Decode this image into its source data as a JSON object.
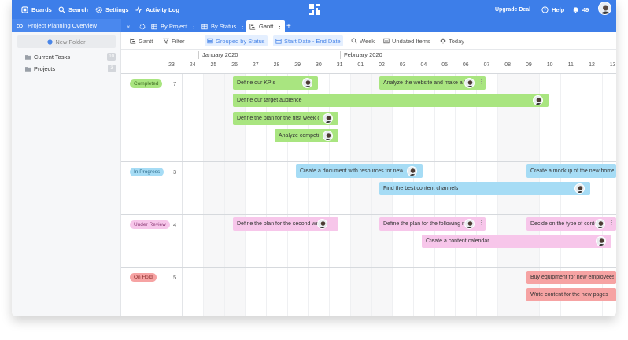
{
  "colors": {
    "accent": "#3d7ee9",
    "completed": "#a9e580",
    "in_progress": "#a6dcf5",
    "under_review": "#f7c6ea",
    "on_hold": "#f6a3a3"
  },
  "topbar": {
    "boards": "Boards",
    "search": "Search",
    "settings": "Settings",
    "activity": "Activity Log",
    "upgrade": "Upgrade Deal",
    "help": "Help",
    "notifications": "49"
  },
  "subbar": {
    "project": "Project Planning Overview",
    "tabs": [
      "By Project",
      "By Status",
      "Gantt"
    ]
  },
  "sidebar": {
    "new_folder": "New Folder",
    "folders": [
      {
        "label": "Current Tasks",
        "count": "10"
      },
      {
        "label": "Projects",
        "count": "3"
      }
    ]
  },
  "toolbar": {
    "gantt": "Gantt",
    "filter": "Filter",
    "grouped": "Grouped by Status",
    "dates": "Start Date - End Date",
    "week": "Week",
    "undated": "Undated Items",
    "today": "Today"
  },
  "timeline": {
    "months": [
      "January 2020",
      "February 2020"
    ],
    "days": [
      "23",
      "24",
      "25",
      "26",
      "27",
      "28",
      "29",
      "30",
      "31",
      "01",
      "02",
      "03",
      "04",
      "05",
      "06",
      "07",
      "08",
      "09",
      "10",
      "11",
      "12",
      "13"
    ]
  },
  "groups": [
    {
      "status": "Completed",
      "count": "7",
      "tasks": [
        "Define our KPIs",
        "Analyze the website and make a list",
        "Define our target audience",
        "Define the plan for the first week of",
        "Analyze competitors"
      ]
    },
    {
      "status": "In Progress",
      "count": "3",
      "tasks": [
        "Create a document with resources for new",
        "Create a mockup of the new home page",
        "Find the best content channels"
      ]
    },
    {
      "status": "Under Review",
      "count": "4",
      "tasks": [
        "Define the plan for the second week",
        "Define the plan for the following m",
        "Decide on the type of content to u",
        "Create a content calendar"
      ]
    },
    {
      "status": "On Hold",
      "count": "5",
      "tasks": [
        "Buy equipment for new employees",
        "Write content for the new pages"
      ]
    }
  ]
}
